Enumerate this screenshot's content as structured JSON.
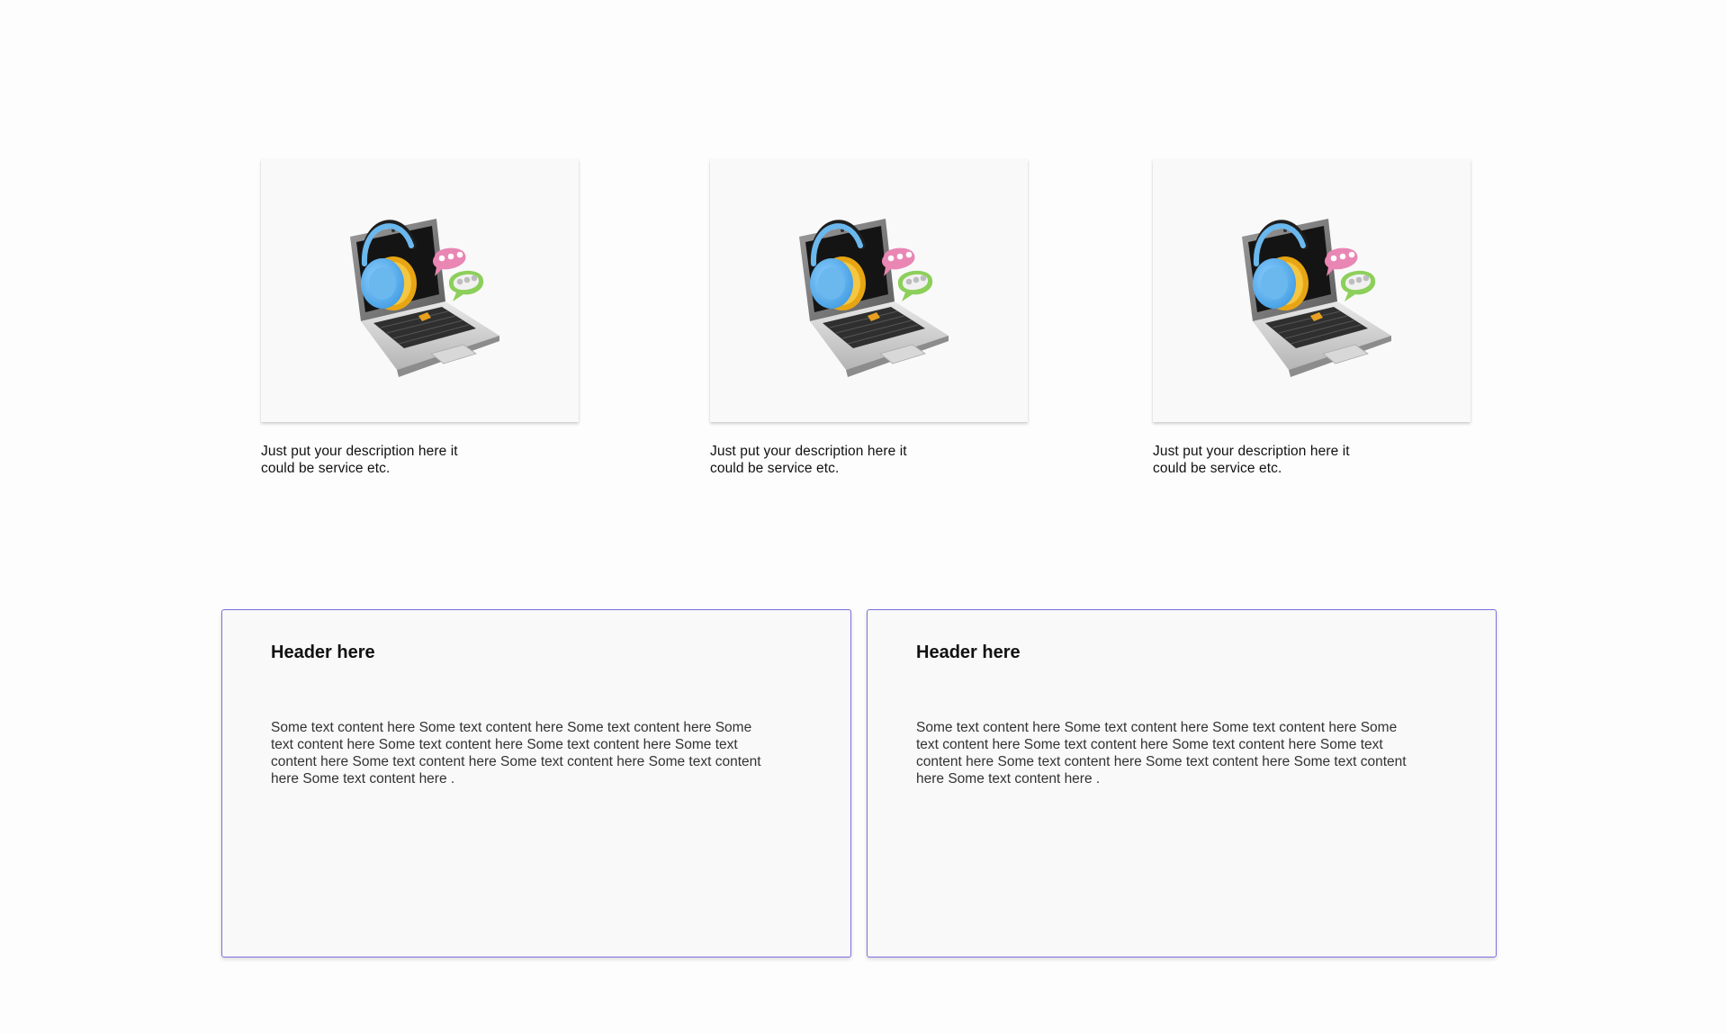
{
  "services": [
    {
      "description": "Just put your description here it could be service etc.",
      "icon": "laptop-support-icon"
    },
    {
      "description": "Just put your description here it could be service etc.",
      "icon": "laptop-support-icon"
    },
    {
      "description": "Just put your description here it could be service etc.",
      "icon": "laptop-support-icon"
    }
  ],
  "cards": [
    {
      "header": "Header here",
      "body": "Some text content here Some text content here Some text content here Some text content here Some text content here Some text content here Some text content here Some text content here Some text content here Some text content here Some text content here ."
    },
    {
      "header": "Header here",
      "body": "Some text content here Some text content here Some text content here Some text content here Some text content here Some text content here Some text content here Some text content here Some text content here Some text content here Some text content here ."
    }
  ],
  "colors": {
    "card_border": "#7b70e0",
    "card_background": "#f9f9f9",
    "page_background": "#fdfdfd"
  }
}
